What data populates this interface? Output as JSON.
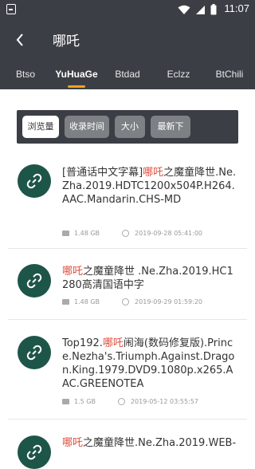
{
  "status": {
    "time": "11:07"
  },
  "header": {
    "title": "哪吒"
  },
  "tabs": [
    {
      "label": "Btso",
      "active": false
    },
    {
      "label": "YuHuaGe",
      "active": true
    },
    {
      "label": "Btdad",
      "active": false
    },
    {
      "label": "Eclzz",
      "active": false
    },
    {
      "label": "BtChili",
      "active": false
    }
  ],
  "filters": [
    {
      "label": "浏览量",
      "active": true
    },
    {
      "label": "收录时间",
      "active": false
    },
    {
      "label": "大小",
      "active": false
    },
    {
      "label": "最新下",
      "active": false
    }
  ],
  "results": [
    {
      "pre": "[普通话中文字幕]",
      "hl": "哪吒",
      "post": "之魔童降世.Ne.Zha.2019.HDTC1200x504P.H264.AAC.Mandarin.CHS-MD",
      "size": "1.48 GB",
      "date": "2019-09-28 05:41:00"
    },
    {
      "pre": "",
      "hl": "哪吒",
      "post": "之魔童降世 .Ne.Zha.2019.HC1280高清国语中字",
      "size": "1.48 GB",
      "date": "2019-09-29 01:59:20"
    },
    {
      "pre": "Top192.",
      "hl": "哪吒",
      "post": "闹海(数码修复版).Prince.Nezha's.Triumph.Against.Dragon.King.1979.DVD9.1080p.x265.AAC.GREENOTEA",
      "size": "1.5 GB",
      "date": "2019-05-12 03:55:57"
    },
    {
      "pre": "",
      "hl": "哪吒",
      "post": "之魔童降世.Ne.Zha.2019.WEB-",
      "size": "",
      "date": ""
    }
  ],
  "colors": {
    "bar": "#3b3f45",
    "accent": "#f0a020",
    "highlight": "#e04b3b",
    "avatar": "#1e5549"
  }
}
